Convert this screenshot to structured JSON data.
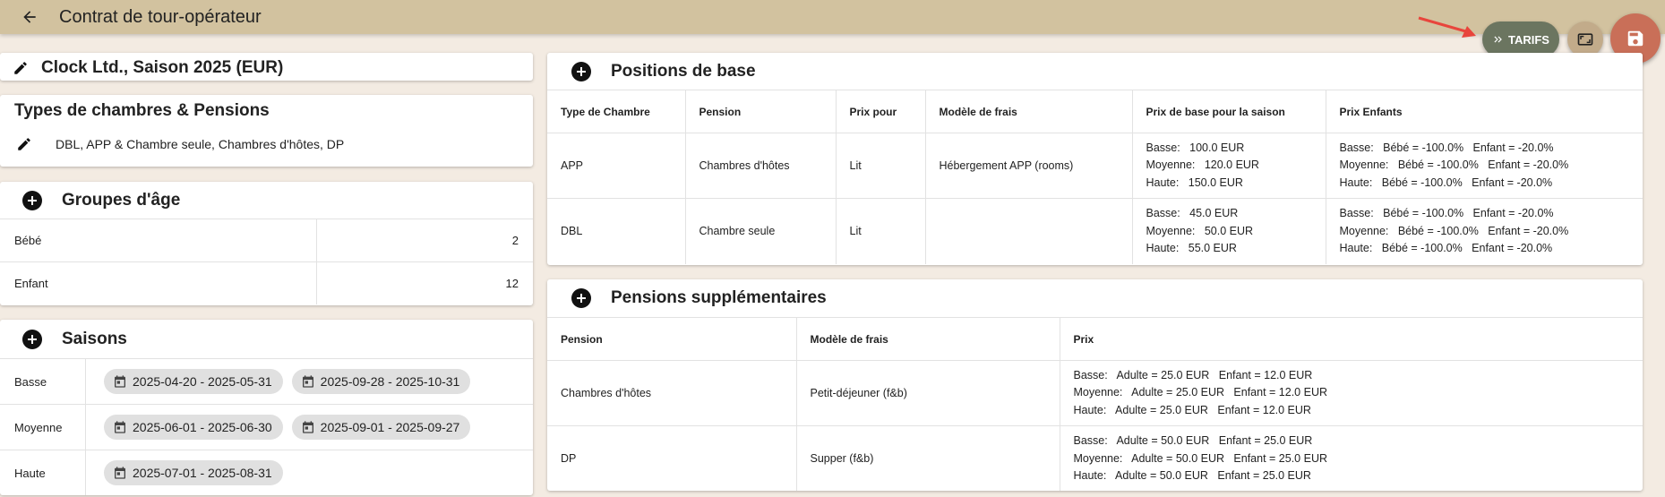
{
  "header": {
    "title": "Contrat de tour-opérateur",
    "back_icon": "arrow-left-icon"
  },
  "actions": {
    "tarifs_label": "TARIFS",
    "tarifs_icon": "double-chevron-right-icon",
    "expand_icon": "expand-frame-icon",
    "save_icon": "floppy-disk-icon",
    "accent": "#6b7560",
    "save_color": "#c96f58"
  },
  "contract": {
    "title": "Clock Ltd., Saison 2025 (EUR)"
  },
  "rooms": {
    "title": "Types de chambres & Pensions",
    "summary": "DBL, APP & Chambre seule, Chambres d'hôtes, DP"
  },
  "age_groups": {
    "title": "Groupes d'âge",
    "rows": [
      {
        "label": "Bébé",
        "value": "2"
      },
      {
        "label": "Enfant",
        "value": "12"
      }
    ]
  },
  "seasons": {
    "title": "Saisons",
    "rows": [
      {
        "label": "Basse",
        "ranges": [
          "2025-04-20 - 2025-05-31",
          "2025-09-28 - 2025-10-31"
        ]
      },
      {
        "label": "Moyenne",
        "ranges": [
          "2025-06-01 - 2025-06-30",
          "2025-09-01 - 2025-09-27"
        ]
      },
      {
        "label": "Haute",
        "ranges": [
          "2025-07-01 - 2025-08-31"
        ]
      }
    ]
  },
  "base_positions": {
    "title": "Positions de base",
    "columns": [
      "Type de Chambre",
      "Pension",
      "Prix pour",
      "Modèle de frais",
      "Prix de base pour la saison",
      "Prix Enfants"
    ],
    "rows": [
      {
        "room": "APP",
        "pension": "Chambres d'hôtes",
        "price_for": "Lit",
        "fee_model": "Hébergement APP (rooms)",
        "base": [
          "Basse:   100.0 EUR",
          "Moyenne:   120.0 EUR",
          "Haute:   150.0 EUR"
        ],
        "children": [
          "Basse:   Bébé = -100.0%   Enfant = -20.0%",
          "Moyenne:   Bébé = -100.0%   Enfant = -20.0%",
          "Haute:   Bébé = -100.0%   Enfant = -20.0%"
        ]
      },
      {
        "room": "DBL",
        "pension": "Chambre seule",
        "price_for": "Lit",
        "fee_model": "",
        "base": [
          "Basse:   45.0 EUR",
          "Moyenne:   50.0 EUR",
          "Haute:   55.0 EUR"
        ],
        "children": [
          "Basse:   Bébé = -100.0%   Enfant = -20.0%",
          "Moyenne:   Bébé = -100.0%   Enfant = -20.0%",
          "Haute:   Bébé = -100.0%   Enfant = -20.0%"
        ]
      }
    ]
  },
  "supplements": {
    "title": "Pensions supplémentaires",
    "columns": [
      "Pension",
      "Modèle de frais",
      "Prix"
    ],
    "rows": [
      {
        "pension": "Chambres d'hôtes",
        "fee_model": "Petit-déjeuner (f&b)",
        "prices": [
          "Basse:   Adulte = 25.0 EUR   Enfant = 12.0 EUR",
          "Moyenne:   Adulte = 25.0 EUR   Enfant = 12.0 EUR",
          "Haute:   Adulte = 25.0 EUR   Enfant = 12.0 EUR"
        ]
      },
      {
        "pension": "DP",
        "fee_model": "Supper (f&b)",
        "prices": [
          "Basse:   Adulte = 50.0 EUR   Enfant = 25.0 EUR",
          "Moyenne:   Adulte = 50.0 EUR   Enfant = 25.0 EUR",
          "Haute:   Adulte = 50.0 EUR   Enfant = 25.0 EUR"
        ]
      }
    ]
  }
}
